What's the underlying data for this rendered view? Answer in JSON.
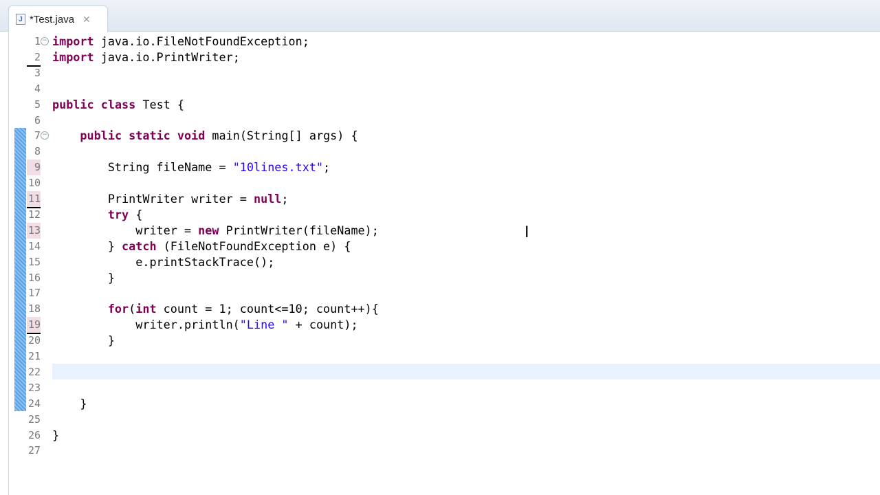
{
  "tab": {
    "title": "*Test.java",
    "icon": "java-file-icon",
    "close": "close-icon"
  },
  "lines": [
    {
      "n": "1",
      "fold": true,
      "seg": [
        {
          "t": "import",
          "c": "k"
        },
        {
          "t": " java.io.FileNotFoundException;"
        }
      ]
    },
    {
      "n": "2",
      "ul": true,
      "seg": [
        {
          "t": "import",
          "c": "k"
        },
        {
          "t": " java.io.PrintWriter;"
        }
      ]
    },
    {
      "n": "3",
      "seg": []
    },
    {
      "n": "4",
      "seg": []
    },
    {
      "n": "5",
      "seg": [
        {
          "t": "public",
          "c": "k"
        },
        {
          "t": " "
        },
        {
          "t": "class",
          "c": "k"
        },
        {
          "t": " Test {"
        }
      ]
    },
    {
      "n": "6",
      "seg": []
    },
    {
      "n": "7",
      "fold": true,
      "seg": [
        {
          "t": "    "
        },
        {
          "t": "public",
          "c": "k"
        },
        {
          "t": " "
        },
        {
          "t": "static",
          "c": "k"
        },
        {
          "t": " "
        },
        {
          "t": "void",
          "c": "k"
        },
        {
          "t": " main(String[] args) {"
        }
      ]
    },
    {
      "n": "8",
      "seg": []
    },
    {
      "n": "9",
      "mark": true,
      "seg": [
        {
          "t": "        String fileName = "
        },
        {
          "t": "\"10lines.txt\"",
          "c": "s"
        },
        {
          "t": ";"
        }
      ]
    },
    {
      "n": "10",
      "seg": []
    },
    {
      "n": "11",
      "mark": true,
      "ul": true,
      "seg": [
        {
          "t": "        PrintWriter writer = "
        },
        {
          "t": "null",
          "c": "k"
        },
        {
          "t": ";"
        }
      ]
    },
    {
      "n": "12",
      "seg": [
        {
          "t": "        "
        },
        {
          "t": "try",
          "c": "k"
        },
        {
          "t": " {"
        }
      ]
    },
    {
      "n": "13",
      "mark": true,
      "seg": [
        {
          "t": "            writer = "
        },
        {
          "t": "new",
          "c": "k"
        },
        {
          "t": " PrintWriter(fileName);"
        }
      ]
    },
    {
      "n": "14",
      "seg": [
        {
          "t": "        } "
        },
        {
          "t": "catch",
          "c": "k"
        },
        {
          "t": " (FileNotFoundException e) {"
        }
      ]
    },
    {
      "n": "15",
      "seg": [
        {
          "t": "            e.printStackTrace();"
        }
      ]
    },
    {
      "n": "16",
      "seg": [
        {
          "t": "        }"
        }
      ]
    },
    {
      "n": "17",
      "seg": []
    },
    {
      "n": "18",
      "seg": [
        {
          "t": "        "
        },
        {
          "t": "for",
          "c": "k"
        },
        {
          "t": "("
        },
        {
          "t": "int",
          "c": "k"
        },
        {
          "t": " count = 1; count<=10; count++){"
        }
      ]
    },
    {
      "n": "19",
      "mark": true,
      "ul": true,
      "seg": [
        {
          "t": "            writer.println("
        },
        {
          "t": "\"Line \"",
          "c": "s"
        },
        {
          "t": " + count);"
        }
      ]
    },
    {
      "n": "20",
      "seg": [
        {
          "t": "        }"
        }
      ]
    },
    {
      "n": "21",
      "seg": []
    },
    {
      "n": "22",
      "seg": []
    },
    {
      "n": "23",
      "seg": []
    },
    {
      "n": "24",
      "seg": [
        {
          "t": "    }"
        }
      ]
    },
    {
      "n": "25",
      "seg": []
    },
    {
      "n": "26",
      "seg": [
        {
          "t": "}"
        }
      ]
    },
    {
      "n": "27",
      "seg": []
    }
  ],
  "colors": {
    "keyword": "#7f0055",
    "string": "#2a00ff",
    "current_line": "#e8f2fe"
  }
}
